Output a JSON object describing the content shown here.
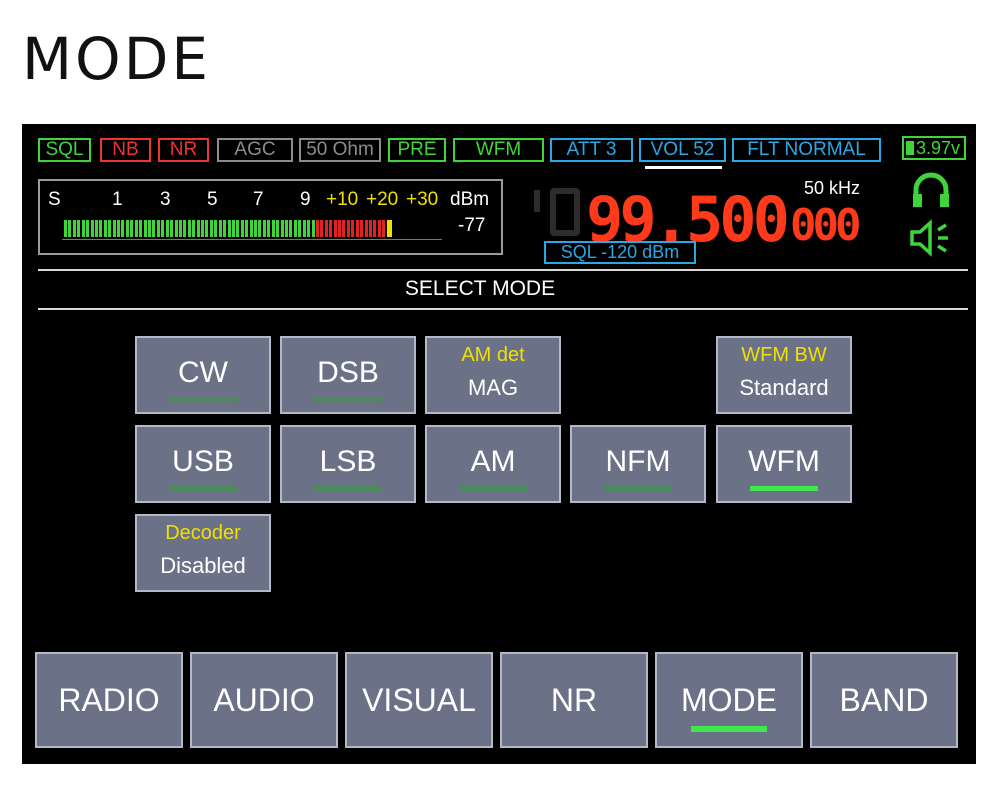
{
  "page_heading": "MODE",
  "status_chips": [
    {
      "label": "SQL",
      "color": "#3fd43a"
    },
    {
      "label": "NB",
      "color": "#e33333"
    },
    {
      "label": "NR",
      "color": "#e33333"
    },
    {
      "label": "AGC",
      "color": "#8c8c8c"
    },
    {
      "label": "50 Ohm",
      "color": "#8c8c8c"
    },
    {
      "label": "PRE",
      "color": "#3fd43a"
    },
    {
      "label": "WFM",
      "color": "#3fd43a"
    },
    {
      "label": "ATT 3",
      "color": "#2aa7e6"
    },
    {
      "label": "VOL 52",
      "color": "#2aa7e6"
    },
    {
      "label": "FLT NORMAL",
      "color": "#2aa7e6"
    }
  ],
  "battery": "3.97v",
  "meter": {
    "scale": [
      "S",
      "1",
      "3",
      "5",
      "7",
      "9"
    ],
    "scale_plus": [
      "+10",
      "+20",
      "+30"
    ],
    "unit": "dBm",
    "reading": "-77"
  },
  "frequency": {
    "main": "99.500",
    "fine": "000",
    "step": "50 kHz"
  },
  "squelch": "SQL -120 dBm",
  "section_title": "SELECT MODE",
  "modes": {
    "cw": "CW",
    "dsb": "DSB",
    "usb": "USB",
    "lsb": "LSB",
    "am": "AM",
    "nfm": "NFM",
    "wfm": "WFM",
    "am_det_title": "AM det",
    "am_det_value": "MAG",
    "wfm_bw_title": "WFM BW",
    "wfm_bw_value": "Standard",
    "decoder_title": "Decoder",
    "decoder_value": "Disabled",
    "selected": "WFM"
  },
  "tabs": {
    "radio": "RADIO",
    "audio": "AUDIO",
    "visual": "VISUAL",
    "nr": "NR",
    "mode": "MODE",
    "band": "BAND",
    "active": "MODE"
  },
  "colors": {
    "accent_green": "#3fe74a",
    "freq_red": "#ff3a1a",
    "button_bg": "#6b7288",
    "label_yellow": "#f0e000"
  }
}
